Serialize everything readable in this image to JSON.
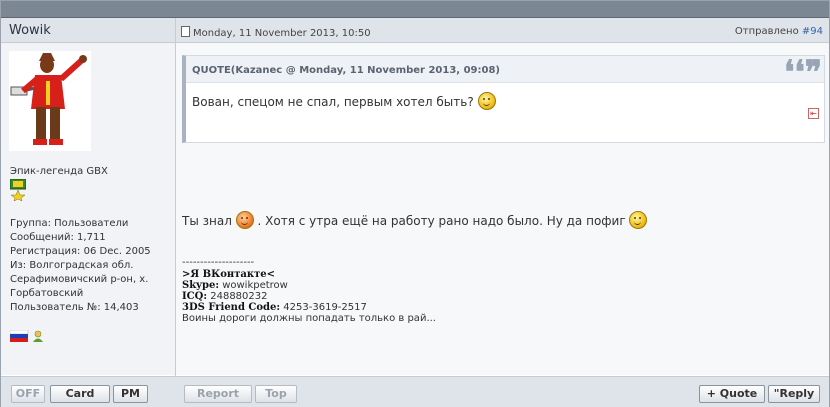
{
  "post": {
    "author": "Wowik",
    "date": "Monday, 11 November 2013, 10:50",
    "sent_label": "Отправлено",
    "post_number": "#94"
  },
  "profile": {
    "rank": "Эпик-легенда GBX",
    "group": "Группа: Пользователи",
    "posts": "Сообщений: 1,711",
    "registered": "Регистрация: 06 Dec. 2005",
    "location_line1": "Из: Волгоградская обл.",
    "location_line2": "Серафимовичский р-он, х.",
    "location_line3": "Горбатовский",
    "user_number": "Пользователь №: 14,403"
  },
  "quote": {
    "title": "QUOTE(Kazanec @ Monday, 11 November 2013, 09:08)",
    "text": "Вован, спецом не спал, первым хотел быть?",
    "marks": "❛❛❞"
  },
  "message": {
    "part1": "Ты знал",
    "part2": ". Хотя с утра ещё на работу рано надо было. Ну да пофиг"
  },
  "signature": {
    "divider": "--------------------",
    "vk": ">Я ВКонтакте<",
    "skype_label": "Skype:",
    "skype_value": "wowikpetrow",
    "icq_label": "ICQ:",
    "icq_value": "248880232",
    "friend_label": "3DS Friend Code:",
    "friend_value": "4253-3619-2517",
    "motto": "Воины дороги должны попадать только в рай..."
  },
  "buttons": {
    "off": "OFF",
    "card": "Card",
    "pm": "PM",
    "report": "Report",
    "top": "Top",
    "quote": "+ Quote",
    "reply": "\"Reply"
  }
}
